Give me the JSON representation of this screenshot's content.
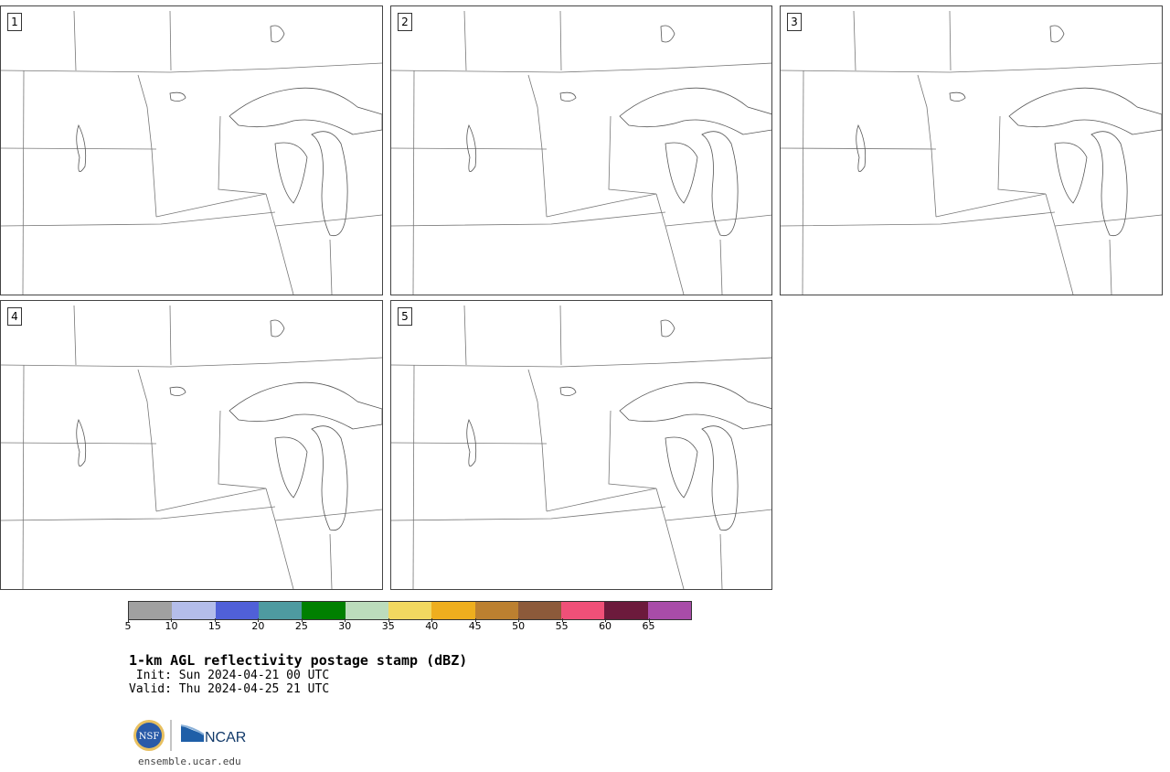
{
  "panels": [
    {
      "label": "1"
    },
    {
      "label": "2"
    },
    {
      "label": "3"
    },
    {
      "label": "4"
    },
    {
      "label": "5"
    }
  ],
  "colorbar": {
    "colors": [
      "#a0a0a0",
      "#b4bdea",
      "#5060d8",
      "#4e9aa0",
      "#008000",
      "#bcdcbc",
      "#f2d860",
      "#eeae1e",
      "#bc8030",
      "#8c5a3a",
      "#f05078",
      "#6c1a3c",
      "#a84ca8"
    ],
    "ticks": [
      "5",
      "10",
      "15",
      "20",
      "25",
      "30",
      "35",
      "40",
      "45",
      "50",
      "55",
      "60",
      "65"
    ]
  },
  "title": "1-km AGL reflectivity postage stamp (dBZ)",
  "init": " Init: Sun 2024-04-21 00 UTC",
  "valid": "Valid: Thu 2024-04-25 21 UTC",
  "logo": {
    "nsf": "NSF",
    "ncar": "NCAR"
  },
  "site": "ensemble.ucar.edu"
}
